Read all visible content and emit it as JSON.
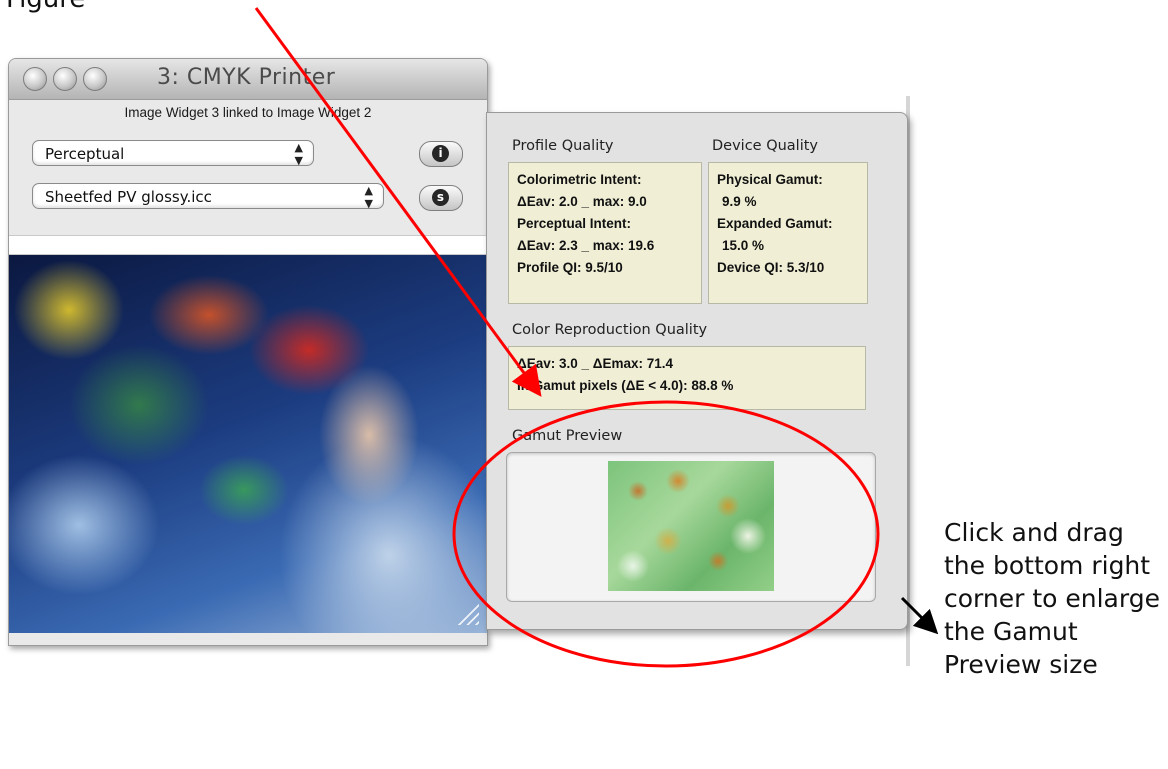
{
  "window": {
    "title": "3: CMYK Printer",
    "link_label": "Image Widget 3 linked to Image Widget 2",
    "intent_select": "Perceptual",
    "profile_select": "Sheetfed PV glossy.icc",
    "info_button_icon": "info-icon",
    "profile_button_icon": "s-icon"
  },
  "panel": {
    "profile_quality": {
      "label": "Profile Quality",
      "lines": [
        "Colorimetric Intent:",
        "ΔEav: 2.0 _ max: 9.0",
        "Perceptual Intent:",
        "ΔEav: 2.3 _ max: 19.6",
        "Profile QI: 9.5/10"
      ]
    },
    "device_quality": {
      "label": "Device Quality",
      "lines": [
        "Physical Gamut:",
        "9.9 %",
        "Expanded Gamut:",
        "15.0 %",
        "Device QI: 5.3/10"
      ]
    },
    "color_reproduction": {
      "label": "Color Reproduction Quality",
      "lines": [
        "ΔEav: 3.0 _ ΔEmax: 71.4",
        "In Gamut pixels (ΔE < 4.0): 88.8 %"
      ]
    },
    "gamut_preview": {
      "label": "Gamut Preview"
    }
  },
  "annotations": {
    "top_note": "Figure",
    "side_note": "Click and drag the bottom right corner to enlarge the Gamut Preview size",
    "arrow_color": "#ff0000",
    "circle_color": "#ff0000"
  }
}
